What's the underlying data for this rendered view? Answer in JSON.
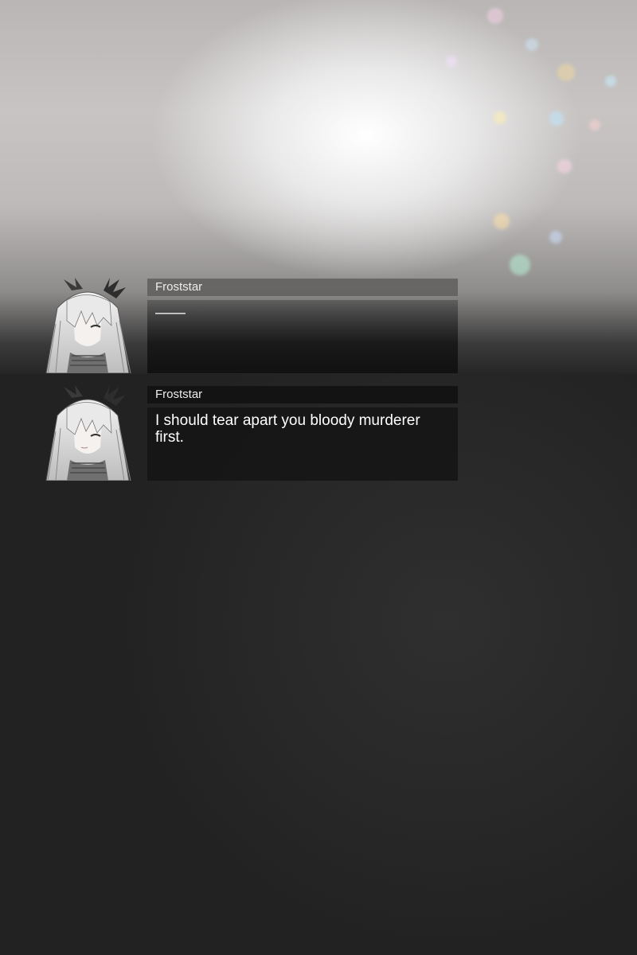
{
  "dialogue": [
    {
      "speaker": "Froststar",
      "text": "——"
    },
    {
      "speaker": "Froststar",
      "text": "I should tear apart you bloody murderer first."
    }
  ]
}
